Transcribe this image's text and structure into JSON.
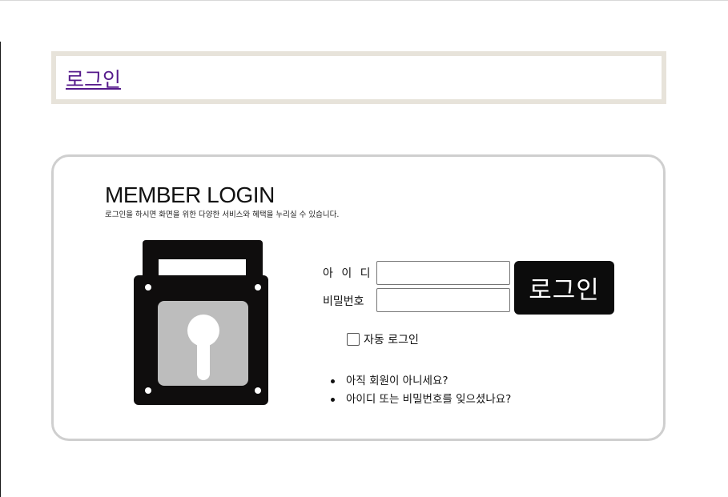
{
  "page": {
    "title_link": "로그인"
  },
  "login_panel": {
    "heading": "MEMBER LOGIN",
    "subheading": "로그인을 하시면 화면을 위한 다양한 서비스와 혜택을 누리실 수 있습니다.",
    "id_label": "아 이 디",
    "id_value": "",
    "password_label": "비밀번호",
    "password_value": "",
    "login_button_label": "로그인",
    "auto_login_label": "자동 로그인",
    "auto_login_checked": false,
    "links": [
      "아직 회원이 아니세요?",
      "아이디 또는 비밀번호를 잊으셨나요?"
    ],
    "lock_icon": "lock-icon"
  },
  "colors": {
    "title_link": "#551a8b",
    "title_border": "#e7e3da",
    "panel_border": "#cfcfcf",
    "button_bg": "#0c0c0c",
    "lock_body": "#0f0d0d",
    "lock_inner": "#bdbdbd"
  }
}
